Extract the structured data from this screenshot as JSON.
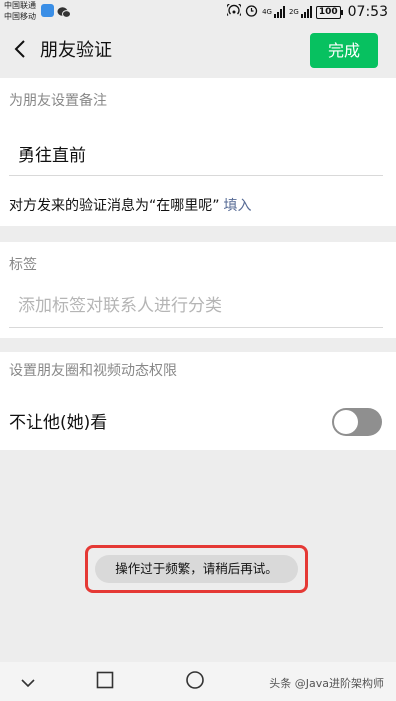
{
  "status_bar": {
    "carrier_1": "中国联通",
    "carrier_2": "中国移动",
    "icons": [
      "app-notification-icon",
      "wechat-icon",
      "hotspot-icon",
      "alarm-icon",
      "4g-signal-icon",
      "2g-signal-icon",
      "battery-icon"
    ],
    "network_4g": "4G",
    "network_2g": "2G",
    "battery": "100",
    "time": "07:53"
  },
  "header": {
    "title": "朋友验证",
    "done_label": "完成",
    "accent_color": "#07c160"
  },
  "remark_section": {
    "label": "为朋友设置备注",
    "input_value": "勇往直前",
    "verify_message": "对方发来的验证消息为“在哪里呢”",
    "fill_link": "填入"
  },
  "tags_section": {
    "label": "标签",
    "input_placeholder": "添加标签对联系人进行分类"
  },
  "permission_section": {
    "label": "设置朋友圈和视频动态权限",
    "toggle_label": "不让他(她)看",
    "toggle_on": false
  },
  "toast": {
    "message": "操作过于频繁，请稍后再试。",
    "highlight_color": "#e53935"
  },
  "system_nav": {
    "icons": [
      "back-chevron-icon",
      "home-square-icon",
      "circle-icon"
    ],
    "watermark": "头条 @Java进阶架构师"
  }
}
